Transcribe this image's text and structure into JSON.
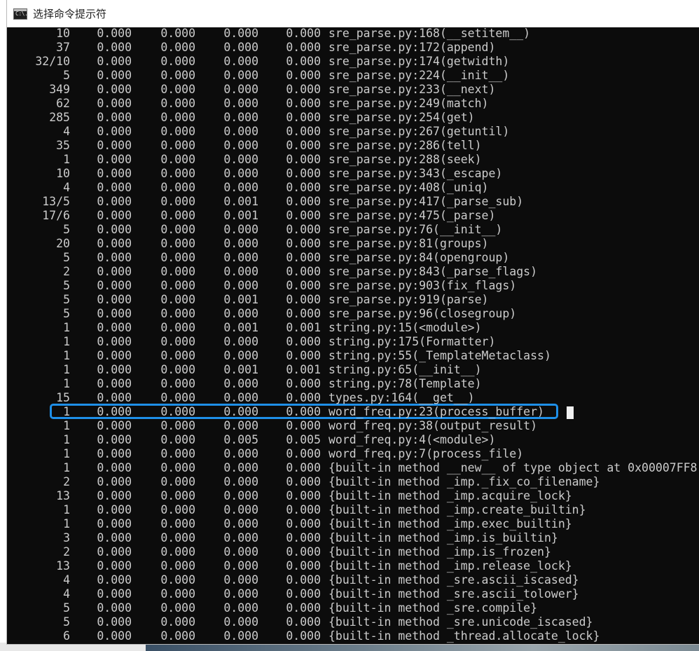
{
  "window": {
    "title": "选择命令提示符",
    "icon": "cmd-icon",
    "icon_glyph": "C:\\."
  },
  "console": {
    "rows": [
      {
        "ncalls": "10",
        "tottime": "0.000",
        "percall1": "0.000",
        "cumtime": "0.000",
        "percall2": "0.000",
        "func": "sre_parse.py:168(__setitem__)"
      },
      {
        "ncalls": "37",
        "tottime": "0.000",
        "percall1": "0.000",
        "cumtime": "0.000",
        "percall2": "0.000",
        "func": "sre_parse.py:172(append)"
      },
      {
        "ncalls": "32/10",
        "tottime": "0.000",
        "percall1": "0.000",
        "cumtime": "0.000",
        "percall2": "0.000",
        "func": "sre_parse.py:174(getwidth)"
      },
      {
        "ncalls": "5",
        "tottime": "0.000",
        "percall1": "0.000",
        "cumtime": "0.000",
        "percall2": "0.000",
        "func": "sre_parse.py:224(__init__)"
      },
      {
        "ncalls": "349",
        "tottime": "0.000",
        "percall1": "0.000",
        "cumtime": "0.000",
        "percall2": "0.000",
        "func": "sre_parse.py:233(__next)"
      },
      {
        "ncalls": "62",
        "tottime": "0.000",
        "percall1": "0.000",
        "cumtime": "0.000",
        "percall2": "0.000",
        "func": "sre_parse.py:249(match)"
      },
      {
        "ncalls": "285",
        "tottime": "0.000",
        "percall1": "0.000",
        "cumtime": "0.000",
        "percall2": "0.000",
        "func": "sre_parse.py:254(get)"
      },
      {
        "ncalls": "4",
        "tottime": "0.000",
        "percall1": "0.000",
        "cumtime": "0.000",
        "percall2": "0.000",
        "func": "sre_parse.py:267(getuntil)"
      },
      {
        "ncalls": "35",
        "tottime": "0.000",
        "percall1": "0.000",
        "cumtime": "0.000",
        "percall2": "0.000",
        "func": "sre_parse.py:286(tell)"
      },
      {
        "ncalls": "1",
        "tottime": "0.000",
        "percall1": "0.000",
        "cumtime": "0.000",
        "percall2": "0.000",
        "func": "sre_parse.py:288(seek)"
      },
      {
        "ncalls": "10",
        "tottime": "0.000",
        "percall1": "0.000",
        "cumtime": "0.000",
        "percall2": "0.000",
        "func": "sre_parse.py:343(_escape)"
      },
      {
        "ncalls": "4",
        "tottime": "0.000",
        "percall1": "0.000",
        "cumtime": "0.000",
        "percall2": "0.000",
        "func": "sre_parse.py:408(_uniq)"
      },
      {
        "ncalls": "13/5",
        "tottime": "0.000",
        "percall1": "0.000",
        "cumtime": "0.001",
        "percall2": "0.000",
        "func": "sre_parse.py:417(_parse_sub)"
      },
      {
        "ncalls": "17/6",
        "tottime": "0.000",
        "percall1": "0.000",
        "cumtime": "0.001",
        "percall2": "0.000",
        "func": "sre_parse.py:475(_parse)"
      },
      {
        "ncalls": "5",
        "tottime": "0.000",
        "percall1": "0.000",
        "cumtime": "0.000",
        "percall2": "0.000",
        "func": "sre_parse.py:76(__init__)"
      },
      {
        "ncalls": "20",
        "tottime": "0.000",
        "percall1": "0.000",
        "cumtime": "0.000",
        "percall2": "0.000",
        "func": "sre_parse.py:81(groups)"
      },
      {
        "ncalls": "5",
        "tottime": "0.000",
        "percall1": "0.000",
        "cumtime": "0.000",
        "percall2": "0.000",
        "func": "sre_parse.py:84(opengroup)"
      },
      {
        "ncalls": "2",
        "tottime": "0.000",
        "percall1": "0.000",
        "cumtime": "0.000",
        "percall2": "0.000",
        "func": "sre_parse.py:843(_parse_flags)"
      },
      {
        "ncalls": "5",
        "tottime": "0.000",
        "percall1": "0.000",
        "cumtime": "0.000",
        "percall2": "0.000",
        "func": "sre_parse.py:903(fix_flags)"
      },
      {
        "ncalls": "5",
        "tottime": "0.000",
        "percall1": "0.000",
        "cumtime": "0.001",
        "percall2": "0.000",
        "func": "sre_parse.py:919(parse)"
      },
      {
        "ncalls": "5",
        "tottime": "0.000",
        "percall1": "0.000",
        "cumtime": "0.000",
        "percall2": "0.000",
        "func": "sre_parse.py:96(closegroup)"
      },
      {
        "ncalls": "1",
        "tottime": "0.000",
        "percall1": "0.000",
        "cumtime": "0.001",
        "percall2": "0.001",
        "func": "string.py:15(<module>)"
      },
      {
        "ncalls": "1",
        "tottime": "0.000",
        "percall1": "0.000",
        "cumtime": "0.000",
        "percall2": "0.000",
        "func": "string.py:175(Formatter)"
      },
      {
        "ncalls": "1",
        "tottime": "0.000",
        "percall1": "0.000",
        "cumtime": "0.000",
        "percall2": "0.000",
        "func": "string.py:55(_TemplateMetaclass)"
      },
      {
        "ncalls": "1",
        "tottime": "0.000",
        "percall1": "0.000",
        "cumtime": "0.001",
        "percall2": "0.001",
        "func": "string.py:65(__init__)"
      },
      {
        "ncalls": "1",
        "tottime": "0.000",
        "percall1": "0.000",
        "cumtime": "0.000",
        "percall2": "0.000",
        "func": "string.py:78(Template)"
      },
      {
        "ncalls": "15",
        "tottime": "0.000",
        "percall1": "0.000",
        "cumtime": "0.000",
        "percall2": "0.000",
        "func": "types.py:164(__get__)"
      },
      {
        "ncalls": "1",
        "tottime": "0.000",
        "percall1": "0.000",
        "cumtime": "0.000",
        "percall2": "0.000",
        "func": "word_freq.py:23(process_buffer)",
        "highlighted": true
      },
      {
        "ncalls": "1",
        "tottime": "0.000",
        "percall1": "0.000",
        "cumtime": "0.000",
        "percall2": "0.000",
        "func": "word_freq.py:38(output_result)"
      },
      {
        "ncalls": "1",
        "tottime": "0.000",
        "percall1": "0.000",
        "cumtime": "0.005",
        "percall2": "0.005",
        "func": "word_freq.py:4(<module>)"
      },
      {
        "ncalls": "1",
        "tottime": "0.000",
        "percall1": "0.000",
        "cumtime": "0.000",
        "percall2": "0.000",
        "func": "word_freq.py:7(process_file)"
      },
      {
        "ncalls": "1",
        "tottime": "0.000",
        "percall1": "0.000",
        "cumtime": "0.000",
        "percall2": "0.000",
        "func": "{built-in method __new__ of type object at 0x00007FF8"
      },
      {
        "ncalls": "2",
        "tottime": "0.000",
        "percall1": "0.000",
        "cumtime": "0.000",
        "percall2": "0.000",
        "func": "{built-in method _imp._fix_co_filename}"
      },
      {
        "ncalls": "13",
        "tottime": "0.000",
        "percall1": "0.000",
        "cumtime": "0.000",
        "percall2": "0.000",
        "func": "{built-in method _imp.acquire_lock}"
      },
      {
        "ncalls": "1",
        "tottime": "0.000",
        "percall1": "0.000",
        "cumtime": "0.000",
        "percall2": "0.000",
        "func": "{built-in method _imp.create_builtin}"
      },
      {
        "ncalls": "1",
        "tottime": "0.000",
        "percall1": "0.000",
        "cumtime": "0.000",
        "percall2": "0.000",
        "func": "{built-in method _imp.exec_builtin}"
      },
      {
        "ncalls": "3",
        "tottime": "0.000",
        "percall1": "0.000",
        "cumtime": "0.000",
        "percall2": "0.000",
        "func": "{built-in method _imp.is_builtin}"
      },
      {
        "ncalls": "2",
        "tottime": "0.000",
        "percall1": "0.000",
        "cumtime": "0.000",
        "percall2": "0.000",
        "func": "{built-in method _imp.is_frozen}"
      },
      {
        "ncalls": "13",
        "tottime": "0.000",
        "percall1": "0.000",
        "cumtime": "0.000",
        "percall2": "0.000",
        "func": "{built-in method _imp.release_lock}"
      },
      {
        "ncalls": "4",
        "tottime": "0.000",
        "percall1": "0.000",
        "cumtime": "0.000",
        "percall2": "0.000",
        "func": "{built-in method _sre.ascii_iscased}"
      },
      {
        "ncalls": "4",
        "tottime": "0.000",
        "percall1": "0.000",
        "cumtime": "0.000",
        "percall2": "0.000",
        "func": "{built-in method _sre.ascii_tolower}"
      },
      {
        "ncalls": "5",
        "tottime": "0.000",
        "percall1": "0.000",
        "cumtime": "0.000",
        "percall2": "0.000",
        "func": "{built-in method _sre.compile}"
      },
      {
        "ncalls": "5",
        "tottime": "0.000",
        "percall1": "0.000",
        "cumtime": "0.000",
        "percall2": "0.000",
        "func": "{built-in method _sre.unicode_iscased}"
      },
      {
        "ncalls": "6",
        "tottime": "0.000",
        "percall1": "0.000",
        "cumtime": "0.000",
        "percall2": "0.000",
        "func": "{built-in method _thread.allocate_lock}"
      }
    ]
  },
  "colors": {
    "console_bg": "#0c0c0c",
    "console_text": "#cccccc",
    "highlight": "#1e8fe8",
    "cursor": "#f0f0f0"
  }
}
